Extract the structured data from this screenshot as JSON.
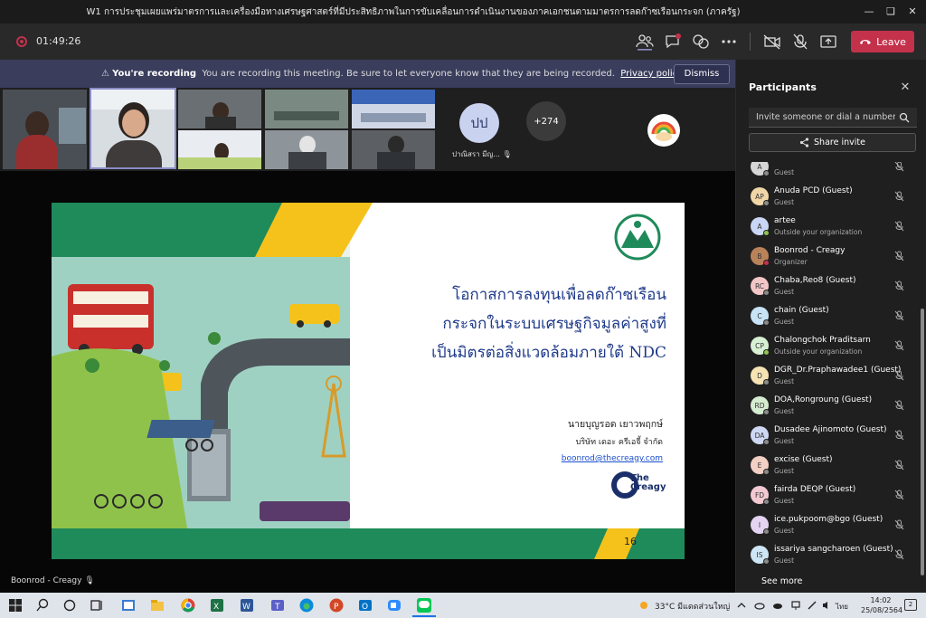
{
  "window": {
    "title": "W1 การประชุมเผยแพร่มาตรการและเครื่องมือทางเศรษฐศาสตร์ที่มีประสิทธิภาพในการขับเคลื่อนการดำเนินงานของภาคเอกชนตามมาตรการลดก๊าซเรือนกระจก (ภาครัฐ)"
  },
  "meeting": {
    "elapsed": "01:49:26",
    "leave_label": "Leave"
  },
  "banner": {
    "title": "You're recording",
    "message": "You are recording this meeting. Be sure to let everyone know that they are being recorded.",
    "link": "Privacy policy",
    "dismiss_label": "Dismiss"
  },
  "gallery": {
    "avatar_initials": "ปป",
    "avatar_name": "ปาณิสรา มีญ...",
    "overflow_count": "+274"
  },
  "slide": {
    "title_lines": [
      "โอกาสการลงทุนเพื่อลดก๊าซเรือน",
      "กระจกในระบบเศรษฐกิจมูลค่าสูงที่",
      "เป็นมิตรต่อสิ่งแวดล้อมภายใต้ NDC"
    ],
    "author": "นายบุญรอด เยาวพฤกษ์",
    "company": "บริษัท เดอะ ครีเอจี้ จำกัด",
    "email": "boonrod@thecreagy.com",
    "logo_text": "The Creagy",
    "page_number": "16"
  },
  "presenter_name": "Boonrod - Creagy",
  "participants": {
    "title": "Participants",
    "invite_placeholder": "Invite someone or dial a number",
    "share_label": "Share invite",
    "see_more": "See more",
    "list": [
      {
        "initials": "A",
        "name": "",
        "role": "Guest",
        "color": "#d6d6d6",
        "status": "#8a8a8a"
      },
      {
        "initials": "AP",
        "name": "Anuda PCD (Guest)",
        "role": "Guest",
        "color": "#f1d7a8",
        "status": "#8a8a8a"
      },
      {
        "initials": "A",
        "name": "artee",
        "role": "Outside your organization",
        "color": "#c9d6f5",
        "status": "#92c353"
      },
      {
        "initials": "B",
        "name": "Boonrod - Creagy",
        "role": "Organizer",
        "color": "#b9835a",
        "status": "#c4314b"
      },
      {
        "initials": "RC",
        "name": "Chaba,Reo8 (Guest)",
        "role": "Guest",
        "color": "#f3c7c7",
        "status": "#8a8a8a"
      },
      {
        "initials": "C",
        "name": "chain (Guest)",
        "role": "Guest",
        "color": "#c7e3f5",
        "status": "#8a8a8a"
      },
      {
        "initials": "CP",
        "name": "Chalongchok Praditsarn",
        "role": "Outside your organization",
        "color": "#d7efd2",
        "status": "#92c353"
      },
      {
        "initials": "D",
        "name": "DGR_Dr.Praphawadee1 (Guest)",
        "role": "Guest",
        "color": "#f5e3b3",
        "status": "#8a8a8a"
      },
      {
        "initials": "RD",
        "name": "DOA,Rongroung (Guest)",
        "role": "Guest",
        "color": "#d6ecd0",
        "status": "#8a8a8a"
      },
      {
        "initials": "DA",
        "name": "Dusadee Ajinomoto (Guest)",
        "role": "Guest",
        "color": "#cfd8f3",
        "status": "#8a8a8a"
      },
      {
        "initials": "E",
        "name": "excise (Guest)",
        "role": "Guest",
        "color": "#f4cfc4",
        "status": "#8a8a8a"
      },
      {
        "initials": "FD",
        "name": "fairda DEQP (Guest)",
        "role": "Guest",
        "color": "#f3c9d2",
        "status": "#8a8a8a"
      },
      {
        "initials": "I",
        "name": "ice.pukpoom@bgo (Guest)",
        "role": "Guest",
        "color": "#e4d4f2",
        "status": "#8a8a8a"
      },
      {
        "initials": "IS",
        "name": "issariya sangcharoen (Guest)",
        "role": "Guest",
        "color": "#cde5f4",
        "status": "#8a8a8a"
      }
    ]
  },
  "taskbar": {
    "weather": "33°C มีแดดส่วนใหญ่",
    "language": "ไทย",
    "time": "14:02",
    "date": "25/08/2564",
    "notifications": "2"
  },
  "colors": {
    "leave": "#c4314b",
    "banner": "#3a3d5c",
    "slide_title": "#1f3a8a",
    "slide_green": "#1f8a5a",
    "slide_yellow": "#f5c21b"
  }
}
